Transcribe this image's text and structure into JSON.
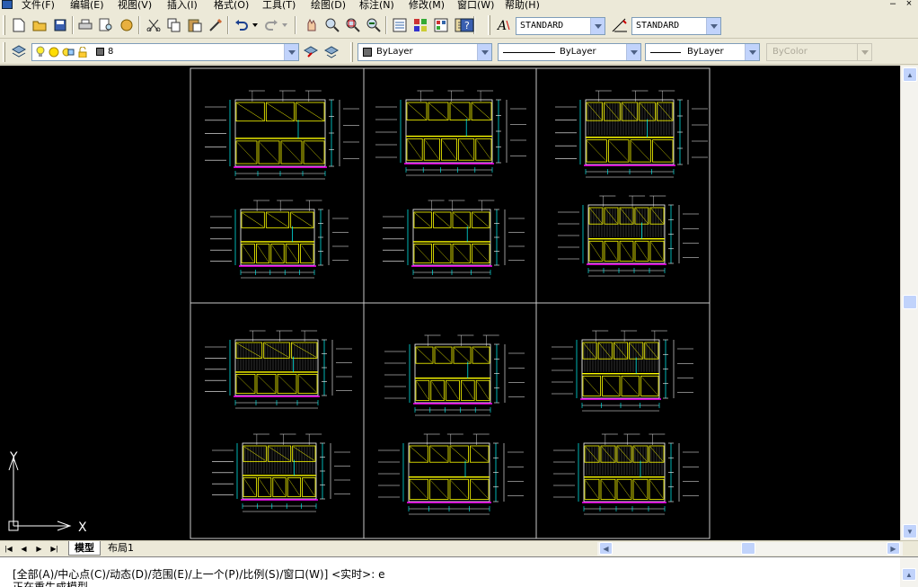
{
  "menu": {
    "items": [
      "文件(F)",
      "编辑(E)",
      "视图(V)",
      "插入(I)",
      "格式(O)",
      "工具(T)",
      "绘图(D)",
      "标注(N)",
      "修改(M)",
      "窗口(W)",
      "帮助(H)"
    ]
  },
  "toolbar": {
    "text_style": "STANDARD",
    "dim_style": "STANDARD",
    "layer": "8",
    "color": "ByLayer",
    "linetype": "ByLayer",
    "lineweight": "ByLayer",
    "plot_style": "ByColor"
  },
  "ucs": {
    "x_label": "X",
    "y_label": "Y"
  },
  "tabs": [
    {
      "label": "模型",
      "active": true
    },
    {
      "label": "布局1",
      "active": false
    }
  ],
  "command": {
    "line1": "[全部(A)/中心点(C)/动态(D)/范围(E)/上一个(P)/比例(S)/窗口(W)] <实时>: e",
    "line2": "正在重生成模型."
  },
  "colors": {
    "canvas": "#000000",
    "frame": "#c8c8c8",
    "dim": "#ffffff",
    "yellow": "#ffff00",
    "cyan": "#00ffff",
    "magenta": "#ff00ff"
  }
}
